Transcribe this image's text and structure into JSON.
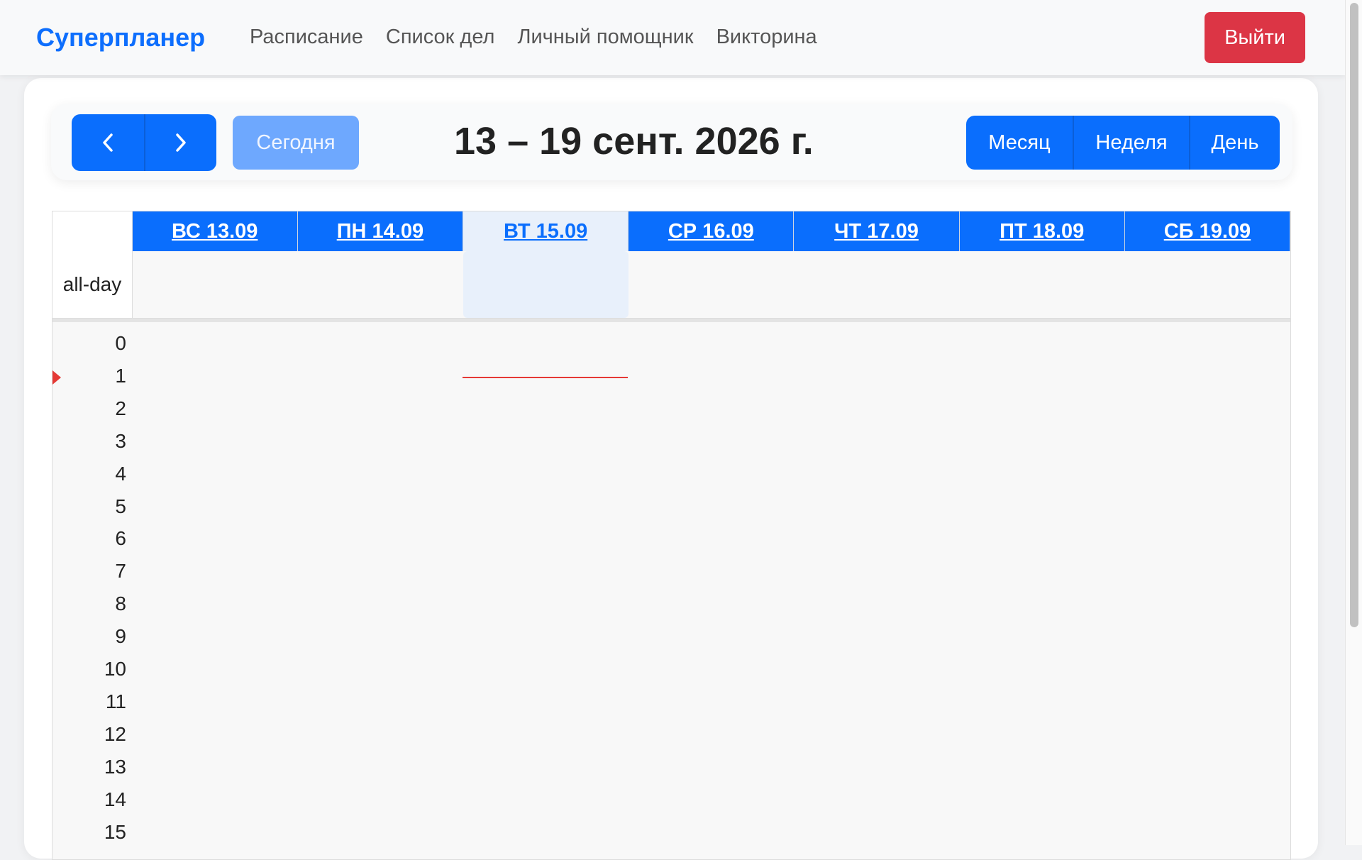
{
  "navbar": {
    "brand": "Суперпланер",
    "links": [
      "Расписание",
      "Список дел",
      "Личный помощник",
      "Викторина"
    ],
    "logout_label": "Выйти"
  },
  "toolbar": {
    "today_label": "Сегодня",
    "range_title": "13 – 19 сент. 2026 г.",
    "views": [
      "Месяц",
      "Неделя",
      "День"
    ]
  },
  "calendar": {
    "days": [
      "ВС 13.09",
      "ПН 14.09",
      "ВТ 15.09",
      "СР 16.09",
      "ЧТ 17.09",
      "ПТ 18.09",
      "СБ 19.09"
    ],
    "today_index": 2,
    "allday_label": "all-day",
    "hours": [
      "0",
      "1",
      "2",
      "3",
      "4",
      "5",
      "6",
      "7",
      "8",
      "9",
      "10",
      "11",
      "12",
      "13",
      "14",
      "15"
    ]
  },
  "colors": {
    "primary": "#0a6efd",
    "danger": "#dc3545",
    "today_bg": "#e8f0fb",
    "now_indicator": "#e53935"
  }
}
